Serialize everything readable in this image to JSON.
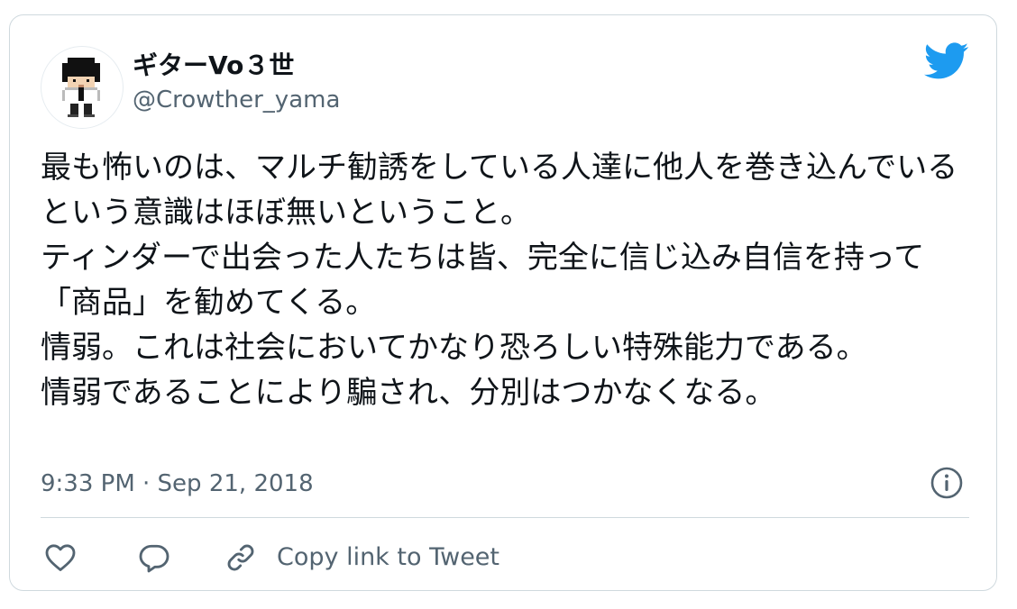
{
  "tweet": {
    "author_name": "ギターVo３世",
    "author_handle": "@Crowther_yama",
    "text": "最も怖いのは、マルチ勧誘をしている人達に他人を巻き込んでいるという意識はほぼ無いということ。\nティンダーで出会った人たちは皆、完全に信じ込み自信を持って「商品」を勧めてくる。\n情弱。これは社会においてかなり恐ろしい特殊能力である。\n情弱であることにより騙され、分別はつかなくなる。",
    "timestamp": "9:33 PM · Sep 21, 2018"
  },
  "actions": {
    "copy_link_label": "Copy link to Tweet"
  },
  "icons": {
    "brand": "twitter-bird-icon",
    "info": "info-icon",
    "like": "heart-icon",
    "reply": "reply-icon",
    "copy": "link-icon"
  },
  "colors": {
    "twitter_blue": "#1d9bf0",
    "secondary_text": "#536471",
    "border": "#cfd9de"
  }
}
